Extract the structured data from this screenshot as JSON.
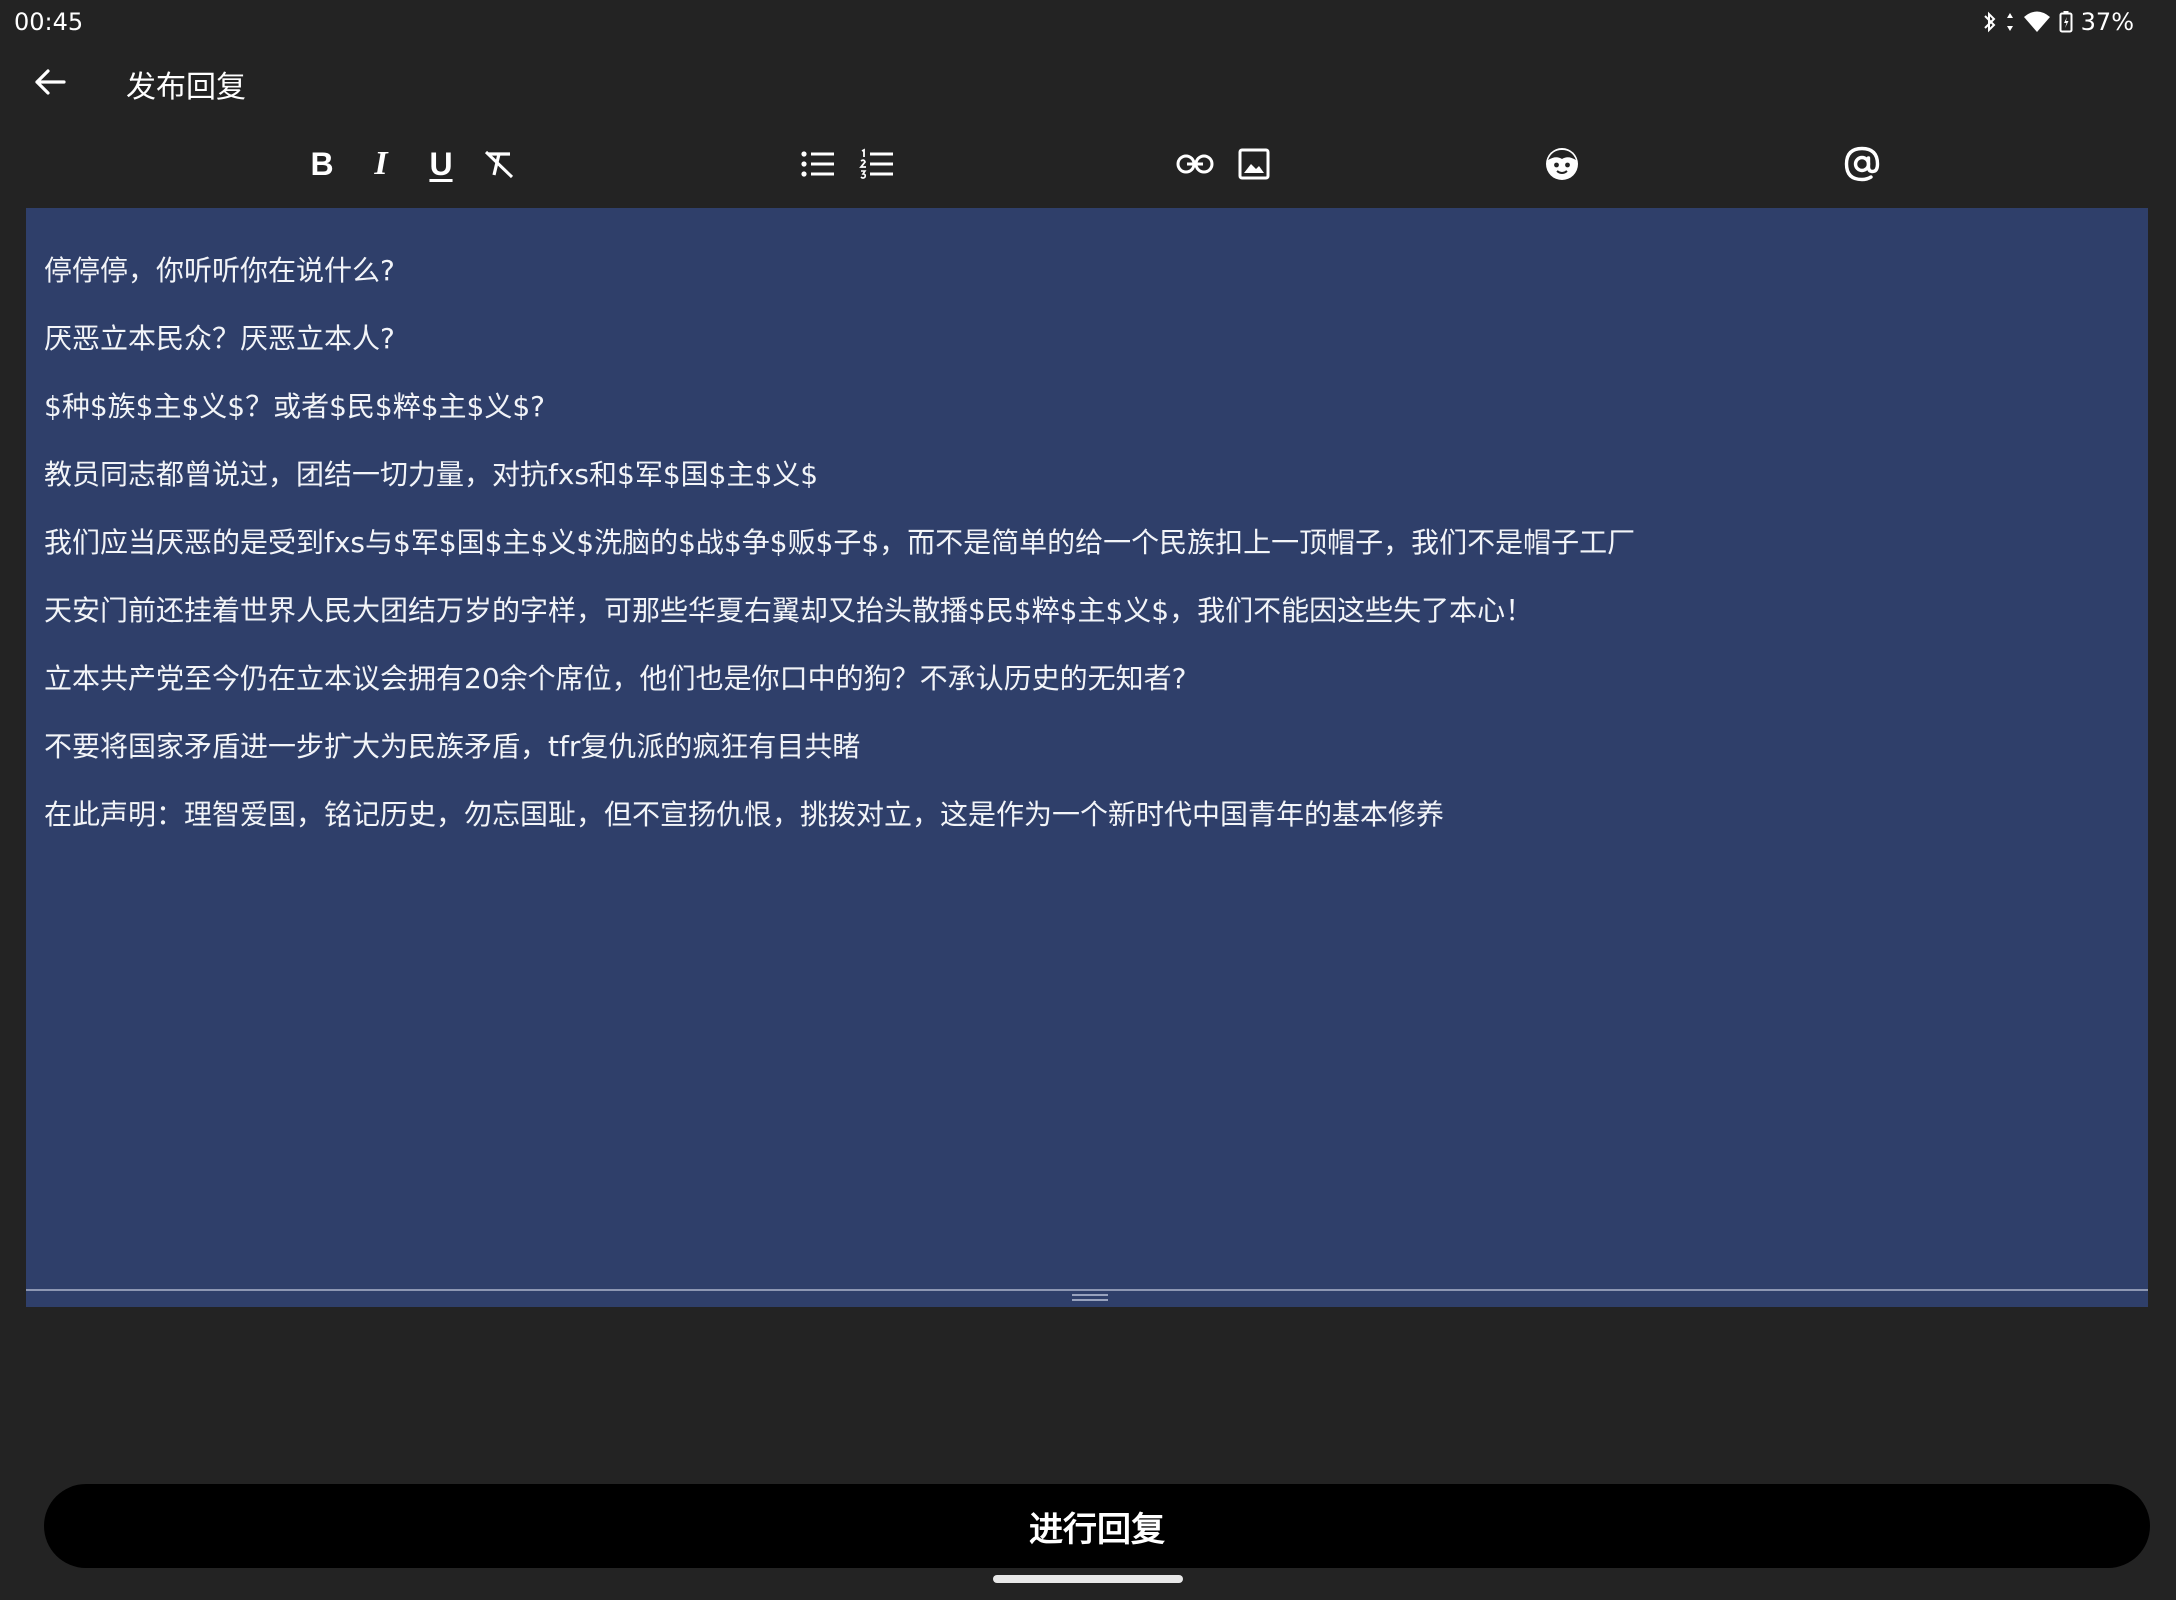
{
  "status_bar": {
    "time": "00:45",
    "battery": "37%"
  },
  "app_bar": {
    "title": "发布回复"
  },
  "toolbar": {
    "bold_label": "B",
    "italic_label": "I",
    "underline_label": "U"
  },
  "editor": {
    "paragraphs": [
      "停停停，你听听你在说什么?",
      "厌恶立本民众？厌恶立本人?",
      "$种$族$主$义$？或者$民$粹$主$义$?",
      "教员同志都曾说过，团结一切力量，对抗fxs和$军$国$主$义$",
      "我们应当厌恶的是受到fxs与$军$国$主$义$洗脑的$战$争$贩$子$，而不是简单的给一个民族扣上一顶帽子，我们不是帽子工厂",
      "天安门前还挂着世界人民大团结万岁的字样，可那些华夏右翼却又抬头散播$民$粹$主$义$，我们不能因这些失了本心！",
      "立本共产党至今仍在立本议会拥有20余个席位，他们也是你口中的狗？不承认历史的无知者?",
      "不要将国家矛盾进一步扩大为民族矛盾，tfr复仇派的疯狂有目共睹",
      "在此声明：理智爱国，铭记历史，勿忘国耻，但不宣扬仇恨，挑拨对立，这是作为一个新时代中国青年的基本修养"
    ]
  },
  "submit": {
    "label": "进行回复"
  },
  "colors": {
    "background": "#232323",
    "editor_background": "#2f3f6a",
    "button_background": "#000000"
  }
}
